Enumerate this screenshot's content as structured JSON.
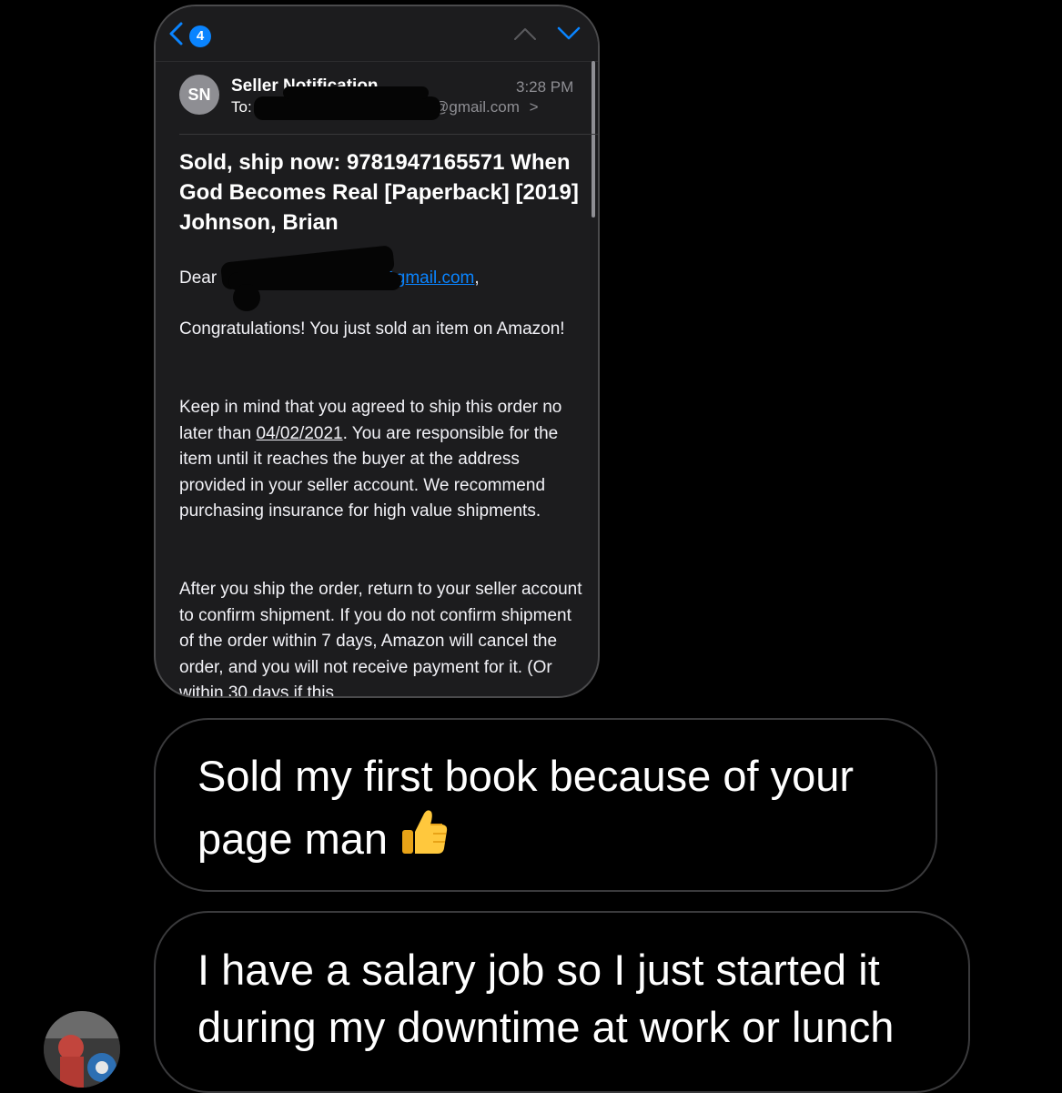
{
  "email": {
    "back_badge_count": "4",
    "avatar_initials": "SN",
    "sender": "Seller Notification",
    "time": "3:28 PM",
    "to_label": "To:",
    "to_address_visible": "@gmail.com",
    "to_chevron": ">",
    "subject": "Sold, ship now: 9781947165571 When God Becomes Real [Paperback] [2019] Johnson, Brian",
    "dear_prefix": "Dear",
    "dear_email_visible": "@gmail.com",
    "dear_suffix": ",",
    "paragraph_1": "Congratulations! You just sold an item on Amazon!",
    "paragraph_2_before_date": "Keep in mind that you agreed to ship this order no later than ",
    "ship_by_date": "04/02/2021",
    "paragraph_2_after_date": ". You are responsible for the item until it reaches the buyer at the address provided in your seller account. We recommend purchasing insurance for high value shipments.",
    "paragraph_3": "After you ship the order, return to your seller account to confirm shipment. If you do not confirm shipment of the order within 7 days, Amazon will cancel the order, and you will not receive payment for it. (Or within 30 days if this",
    "colors": {
      "accent": "#0a84ff",
      "card": "#1c1c1e",
      "secondary_text": "#8e8e93"
    }
  },
  "messages": [
    {
      "text": "Sold my first book because of your page man",
      "emoji": "thumbs-up-icon"
    },
    {
      "text": "I have a salary job so I just started it during my downtime at work or lunch"
    }
  ]
}
